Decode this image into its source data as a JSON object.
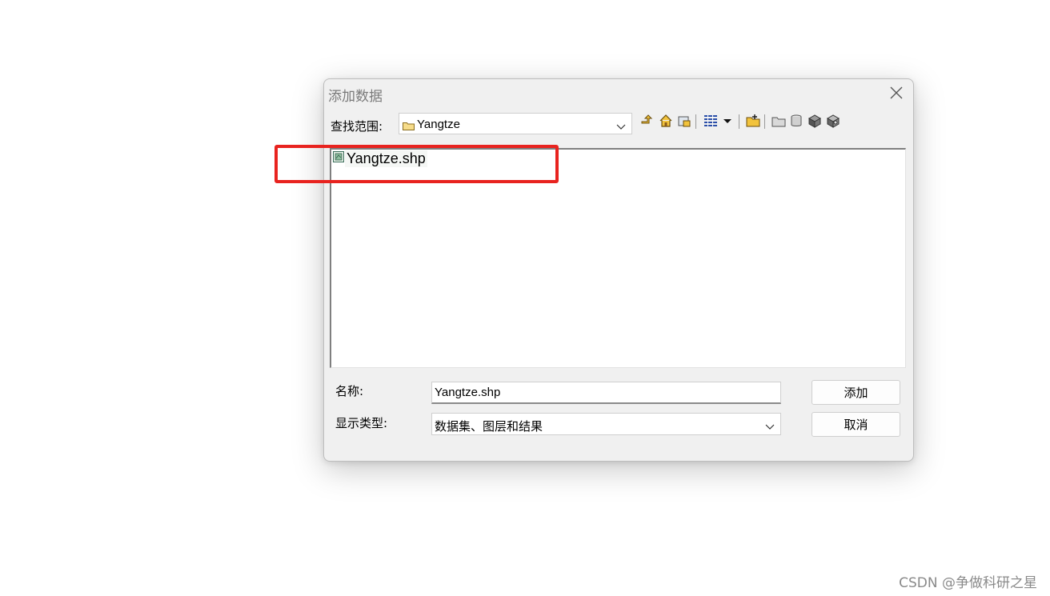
{
  "dialog": {
    "title": "添加数据",
    "look_in_label": "查找范围:",
    "look_in_value": "Yangtze",
    "toolbar_icons": [
      "up-one-level-icon",
      "home-icon",
      "connect-folder-icon",
      "list-view-icon",
      "view-dropdown-icon",
      "new-folder-icon",
      "folder-icon",
      "database-icon",
      "gis-server-icon",
      "toolbox-icon"
    ],
    "files": [
      {
        "name": "Yangtze.shp",
        "icon": "shapefile-icon"
      }
    ],
    "name_label": "名称:",
    "name_value": "Yangtze.shp",
    "type_label": "显示类型:",
    "type_value": "数据集、图层和结果",
    "add_button": "添加",
    "cancel_button": "取消"
  },
  "annotation": {
    "color": "#e8231f"
  },
  "watermark": "CSDN @争做科研之星"
}
